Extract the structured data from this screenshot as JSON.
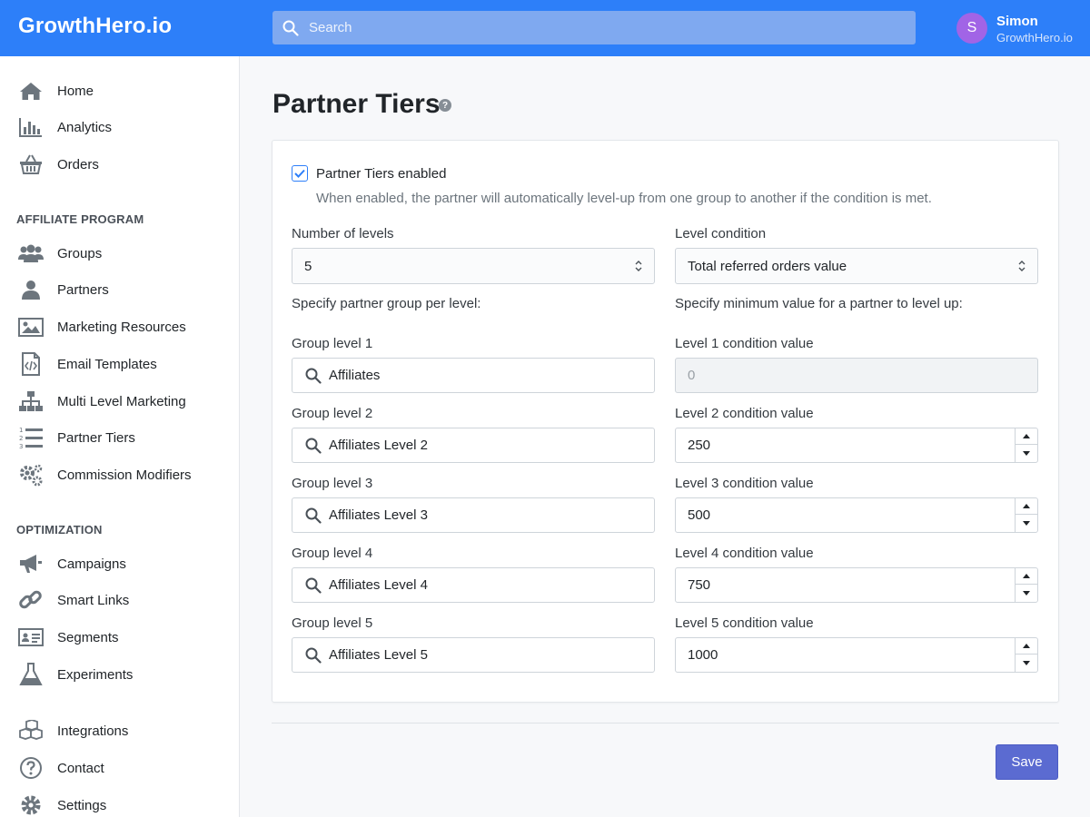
{
  "header": {
    "brand": "GrowthHero.io",
    "search_placeholder": "Search",
    "user": {
      "initial": "S",
      "name": "Simon",
      "org": "GrowthHero.io"
    }
  },
  "sidebar": {
    "items_top": [
      {
        "label": "Home",
        "icon": "home-icon"
      },
      {
        "label": "Analytics",
        "icon": "bar-chart-icon"
      },
      {
        "label": "Orders",
        "icon": "basket-icon"
      }
    ],
    "section_affiliate": "AFFILIATE PROGRAM",
    "items_affiliate": [
      {
        "label": "Groups",
        "icon": "users-icon"
      },
      {
        "label": "Partners",
        "icon": "user-icon"
      },
      {
        "label": "Marketing Resources",
        "icon": "image-icon"
      },
      {
        "label": "Email Templates",
        "icon": "code-file-icon"
      },
      {
        "label": "Multi Level Marketing",
        "icon": "sitemap-icon"
      },
      {
        "label": "Partner Tiers",
        "icon": "numbered-list-icon"
      },
      {
        "label": "Commission Modifiers",
        "icon": "gears-icon"
      }
    ],
    "section_optimization": "OPTIMIZATION",
    "items_optimization": [
      {
        "label": "Campaigns",
        "icon": "megaphone-icon"
      },
      {
        "label": "Smart Links",
        "icon": "link-icon"
      },
      {
        "label": "Segments",
        "icon": "id-card-icon"
      },
      {
        "label": "Experiments",
        "icon": "flask-icon"
      }
    ],
    "items_bottom": [
      {
        "label": "Integrations",
        "icon": "cubes-icon"
      },
      {
        "label": "Contact",
        "icon": "question-circle-icon"
      },
      {
        "label": "Settings",
        "icon": "cog-icon"
      }
    ]
  },
  "page": {
    "title": "Partner Tiers",
    "help_glyph": "?"
  },
  "form": {
    "enabled_label": "Partner Tiers enabled",
    "enabled_checked": true,
    "enabled_help": "When enabled, the partner will automatically level-up from one group to another if the condition is met.",
    "levels_label": "Number of levels",
    "levels_value": "5",
    "condition_label": "Level condition",
    "condition_value": "Total referred orders value",
    "group_hint": "Specify partner group per level:",
    "value_hint": "Specify minimum value for a partner to level up:",
    "levels": [
      {
        "group_label": "Group level 1",
        "group": "Affiliates",
        "cond_label": "Level 1 condition value",
        "cond_value": "0",
        "disabled": true
      },
      {
        "group_label": "Group level 2",
        "group": "Affiliates Level 2",
        "cond_label": "Level 2 condition value",
        "cond_value": "250",
        "disabled": false
      },
      {
        "group_label": "Group level 3",
        "group": "Affiliates Level 3",
        "cond_label": "Level 3 condition value",
        "cond_value": "500",
        "disabled": false
      },
      {
        "group_label": "Group level 4",
        "group": "Affiliates Level 4",
        "cond_label": "Level 4 condition value",
        "cond_value": "750",
        "disabled": false
      },
      {
        "group_label": "Group level 5",
        "group": "Affiliates Level 5",
        "cond_label": "Level 5 condition value",
        "cond_value": "1000",
        "disabled": false
      }
    ],
    "save_label": "Save"
  },
  "colors": {
    "topbar": "#2d7ff9",
    "avatar": "#a164e6",
    "save_button": "#5b6bd1",
    "icon_gray": "#6c757d"
  }
}
